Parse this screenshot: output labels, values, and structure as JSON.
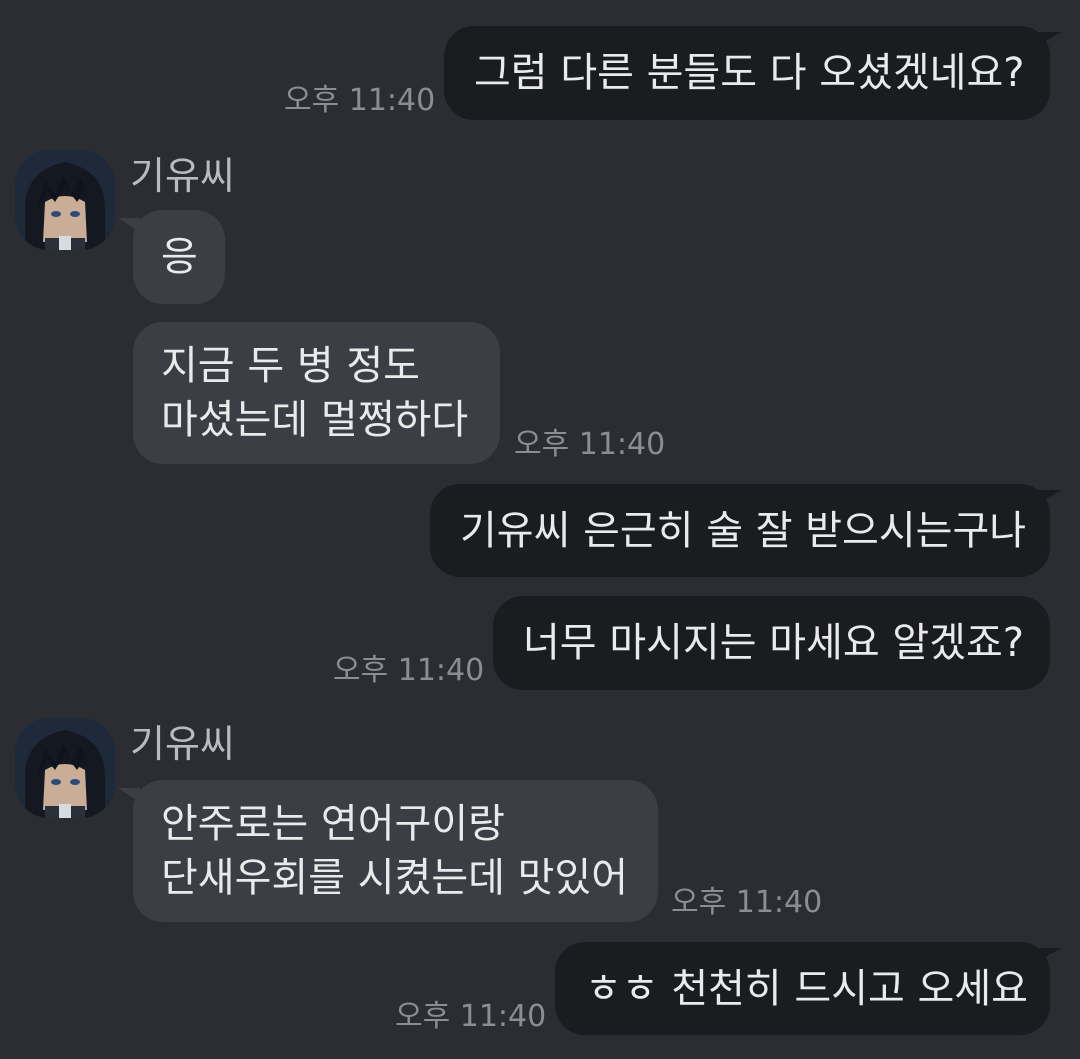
{
  "contact": {
    "name": "기유씨"
  },
  "messages": [
    {
      "side": "out",
      "text": "그럼 다른 분들도 다 오셨겠네요?",
      "time": "오후 11:40"
    },
    {
      "side": "in",
      "text": "응"
    },
    {
      "side": "in",
      "text": "지금 두 병 정도\n마셨는데 멀쩡하다",
      "time": "오후 11:40"
    },
    {
      "side": "out",
      "text": "기유씨 은근히 술 잘 받으시는구나"
    },
    {
      "side": "out",
      "text": "너무 마시지는 마세요 알겠죠?",
      "time": "오후 11:40"
    },
    {
      "side": "in",
      "text": "안주로는 연어구이랑\n단새우회를 시켰는데 맛있어",
      "time": "오후 11:40"
    },
    {
      "side": "out",
      "text": "ㅎㅎ 천천히 드시고 오세요",
      "time": "오후 11:40"
    }
  ],
  "colors": {
    "background": "#2b2d33",
    "outgoing_bubble": "#1b1c1f",
    "incoming_bubble": "#3b3e45",
    "timestamp": "#8a8d93"
  },
  "icons": {
    "avatar": "contact-avatar-anime-portrait"
  }
}
